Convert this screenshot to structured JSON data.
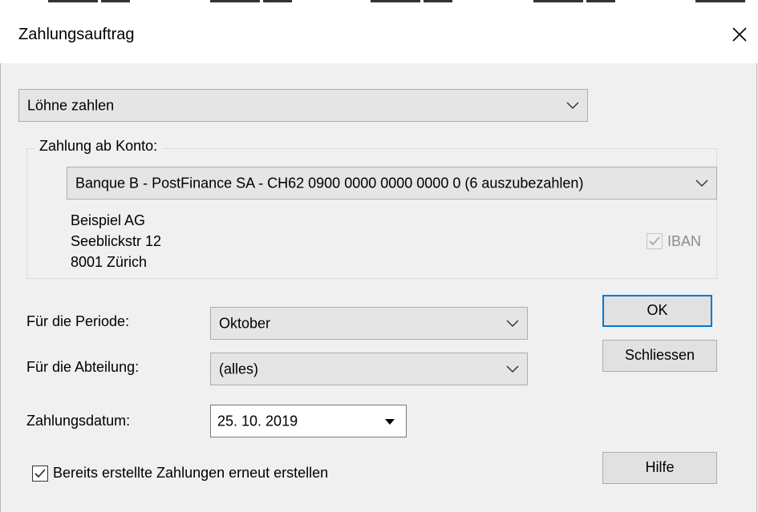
{
  "dialog": {
    "title": "Zahlungsauftrag",
    "close_icon": "close-icon"
  },
  "job": {
    "selected": "Löhne zahlen"
  },
  "account_group": {
    "label": "Zahlung ab Konto:",
    "account_selected": "Banque B - PostFinance SA - CH62 0900 0000 0000 0000 0 (6 auszubezahlen)",
    "address_line1": "Beispiel AG",
    "address_line2": "Seeblickstr 12",
    "address_line3": "8001 Zürich",
    "iban_label": "IBAN",
    "iban_checked": true,
    "iban_disabled": true
  },
  "period": {
    "label": "Für die Periode:",
    "selected": "Oktober"
  },
  "department": {
    "label": "Für die Abteilung:",
    "selected": "(alles)"
  },
  "payment_date": {
    "label": "Zahlungsdatum:",
    "value": "25. 10. 2019"
  },
  "recreate": {
    "label": "Bereits erstellte Zahlungen erneut erstellen",
    "checked": true
  },
  "buttons": {
    "ok": "OK",
    "close": "Schliessen",
    "help": "Hilfe"
  },
  "colors": {
    "focus_border": "#0078d7",
    "dialog_bg": "#f0f0f0"
  }
}
